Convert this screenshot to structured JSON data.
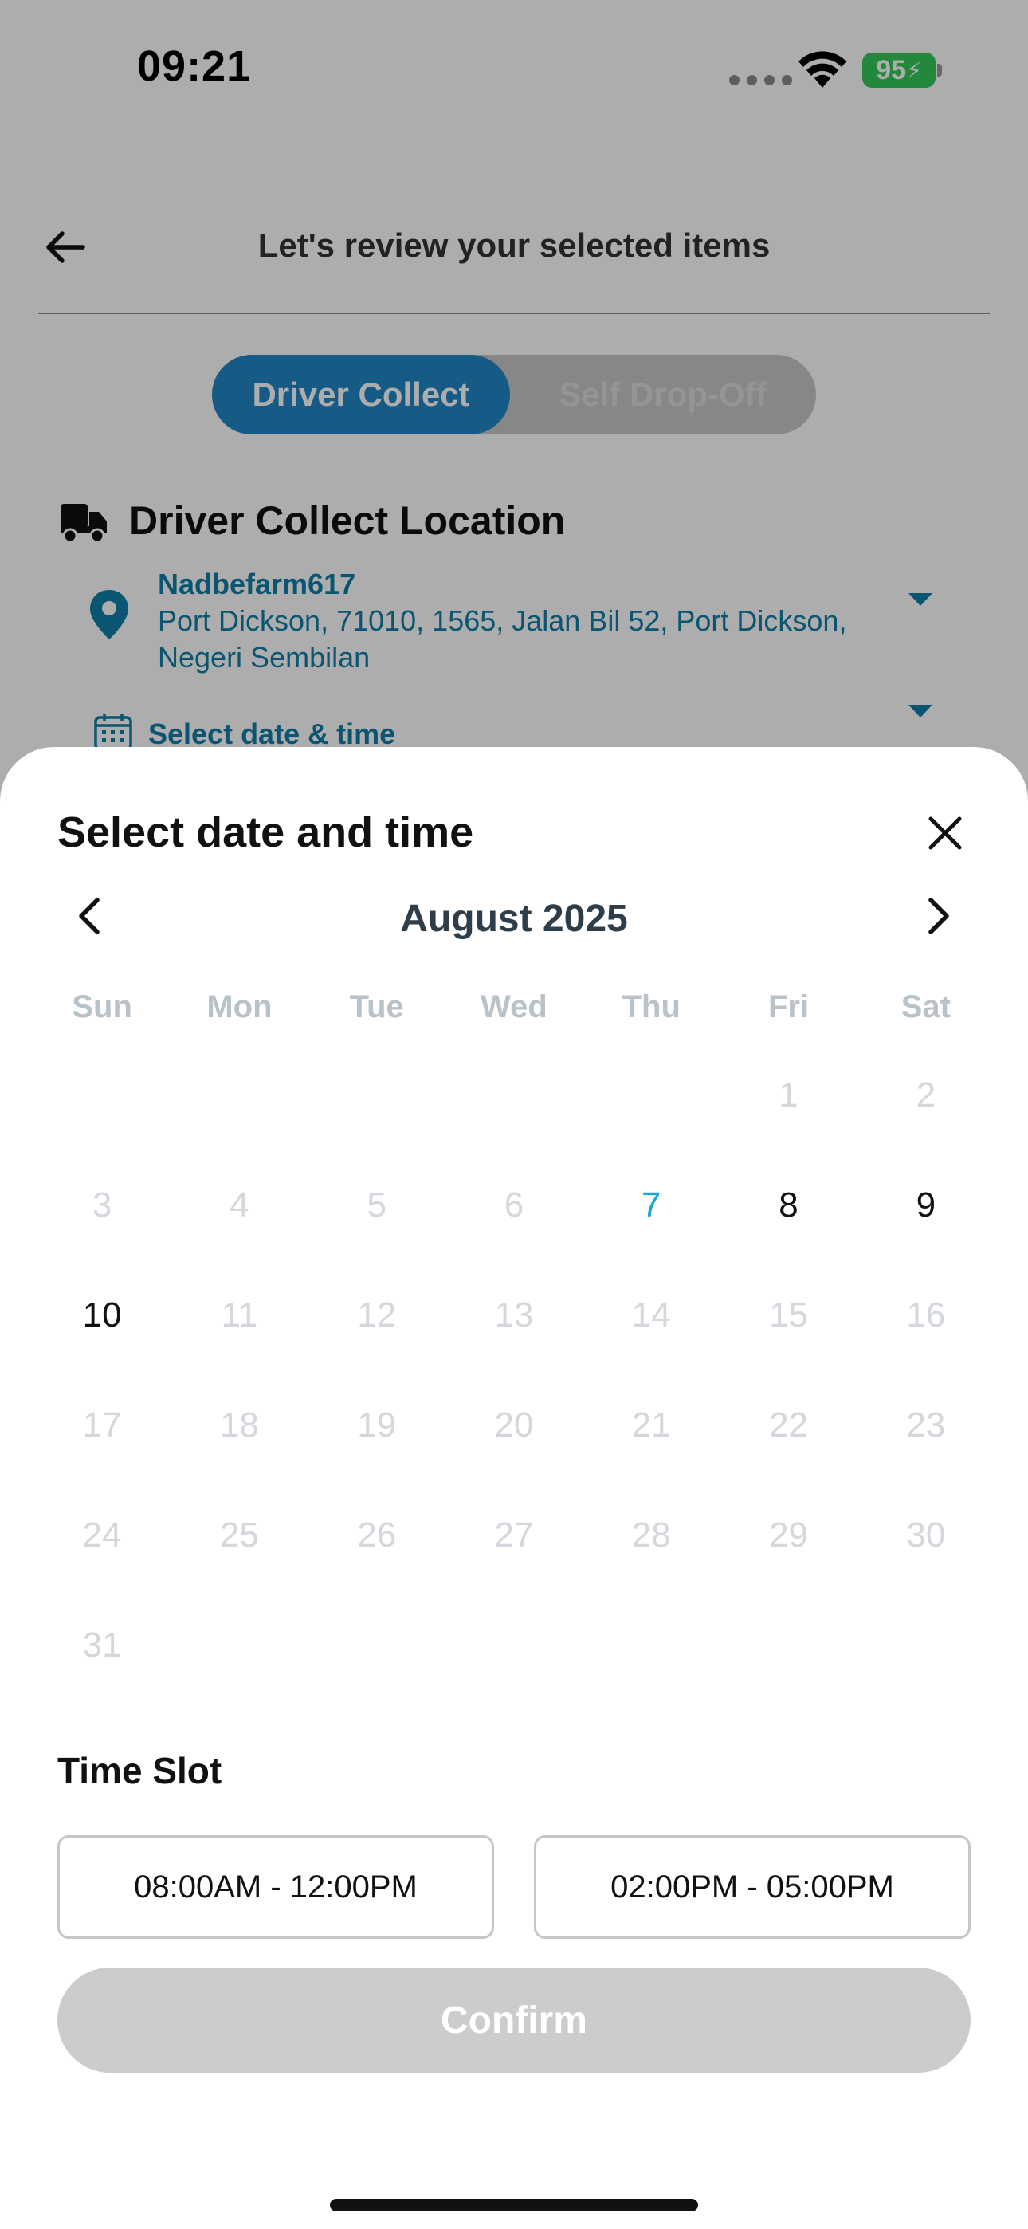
{
  "status_bar": {
    "time": "09:21",
    "battery": "95"
  },
  "header": {
    "title": "Let's review your selected items"
  },
  "mode_toggle": {
    "active": "Driver Collect",
    "inactive": "Self Drop-Off"
  },
  "location": {
    "section_title": "Driver Collect Location",
    "name": "Nadbefarm617",
    "address": "Port Dickson, 71010, 1565, Jalan Bil 52, Port Dickson, Negeri Sembilan",
    "select_datetime": "Select date & time"
  },
  "sheet": {
    "title": "Select date and time",
    "month": "August 2025",
    "weekdays": [
      "Sun",
      "Mon",
      "Tue",
      "Wed",
      "Thu",
      "Fri",
      "Sat"
    ],
    "weeks": [
      [
        {
          "d": "",
          "s": "empty"
        },
        {
          "d": "",
          "s": "empty"
        },
        {
          "d": "",
          "s": "empty"
        },
        {
          "d": "",
          "s": "empty"
        },
        {
          "d": "",
          "s": "empty"
        },
        {
          "d": "1",
          "s": "disabled"
        },
        {
          "d": "2",
          "s": "disabled"
        }
      ],
      [
        {
          "d": "3",
          "s": "disabled"
        },
        {
          "d": "4",
          "s": "disabled"
        },
        {
          "d": "5",
          "s": "disabled"
        },
        {
          "d": "6",
          "s": "disabled"
        },
        {
          "d": "7",
          "s": "today"
        },
        {
          "d": "8",
          "s": "available"
        },
        {
          "d": "9",
          "s": "available"
        }
      ],
      [
        {
          "d": "10",
          "s": "available"
        },
        {
          "d": "11",
          "s": "disabled"
        },
        {
          "d": "12",
          "s": "disabled"
        },
        {
          "d": "13",
          "s": "disabled"
        },
        {
          "d": "14",
          "s": "disabled"
        },
        {
          "d": "15",
          "s": "disabled"
        },
        {
          "d": "16",
          "s": "disabled"
        }
      ],
      [
        {
          "d": "17",
          "s": "disabled"
        },
        {
          "d": "18",
          "s": "disabled"
        },
        {
          "d": "19",
          "s": "disabled"
        },
        {
          "d": "20",
          "s": "disabled"
        },
        {
          "d": "21",
          "s": "disabled"
        },
        {
          "d": "22",
          "s": "disabled"
        },
        {
          "d": "23",
          "s": "disabled"
        }
      ],
      [
        {
          "d": "24",
          "s": "disabled"
        },
        {
          "d": "25",
          "s": "disabled"
        },
        {
          "d": "26",
          "s": "disabled"
        },
        {
          "d": "27",
          "s": "disabled"
        },
        {
          "d": "28",
          "s": "disabled"
        },
        {
          "d": "29",
          "s": "disabled"
        },
        {
          "d": "30",
          "s": "disabled"
        }
      ],
      [
        {
          "d": "31",
          "s": "disabled"
        },
        {
          "d": "",
          "s": "empty"
        },
        {
          "d": "",
          "s": "empty"
        },
        {
          "d": "",
          "s": "empty"
        },
        {
          "d": "",
          "s": "empty"
        },
        {
          "d": "",
          "s": "empty"
        },
        {
          "d": "",
          "s": "empty"
        }
      ]
    ],
    "time_slot_title": "Time Slot",
    "time_slots": [
      "08:00AM - 12:00PM",
      "02:00PM - 05:00PM"
    ],
    "confirm_label": "Confirm"
  },
  "colors": {
    "brand_blue": "#1f86c6",
    "link_teal": "#107ea8",
    "today_blue": "#19a6db",
    "battery_green": "#34c759",
    "disabled_button": "#cccccc"
  },
  "icons": [
    "back-arrow-icon",
    "truck-icon",
    "location-pin-icon",
    "calendar-icon",
    "close-icon",
    "chevron-left-icon",
    "chevron-right-icon",
    "wifi-icon"
  ]
}
